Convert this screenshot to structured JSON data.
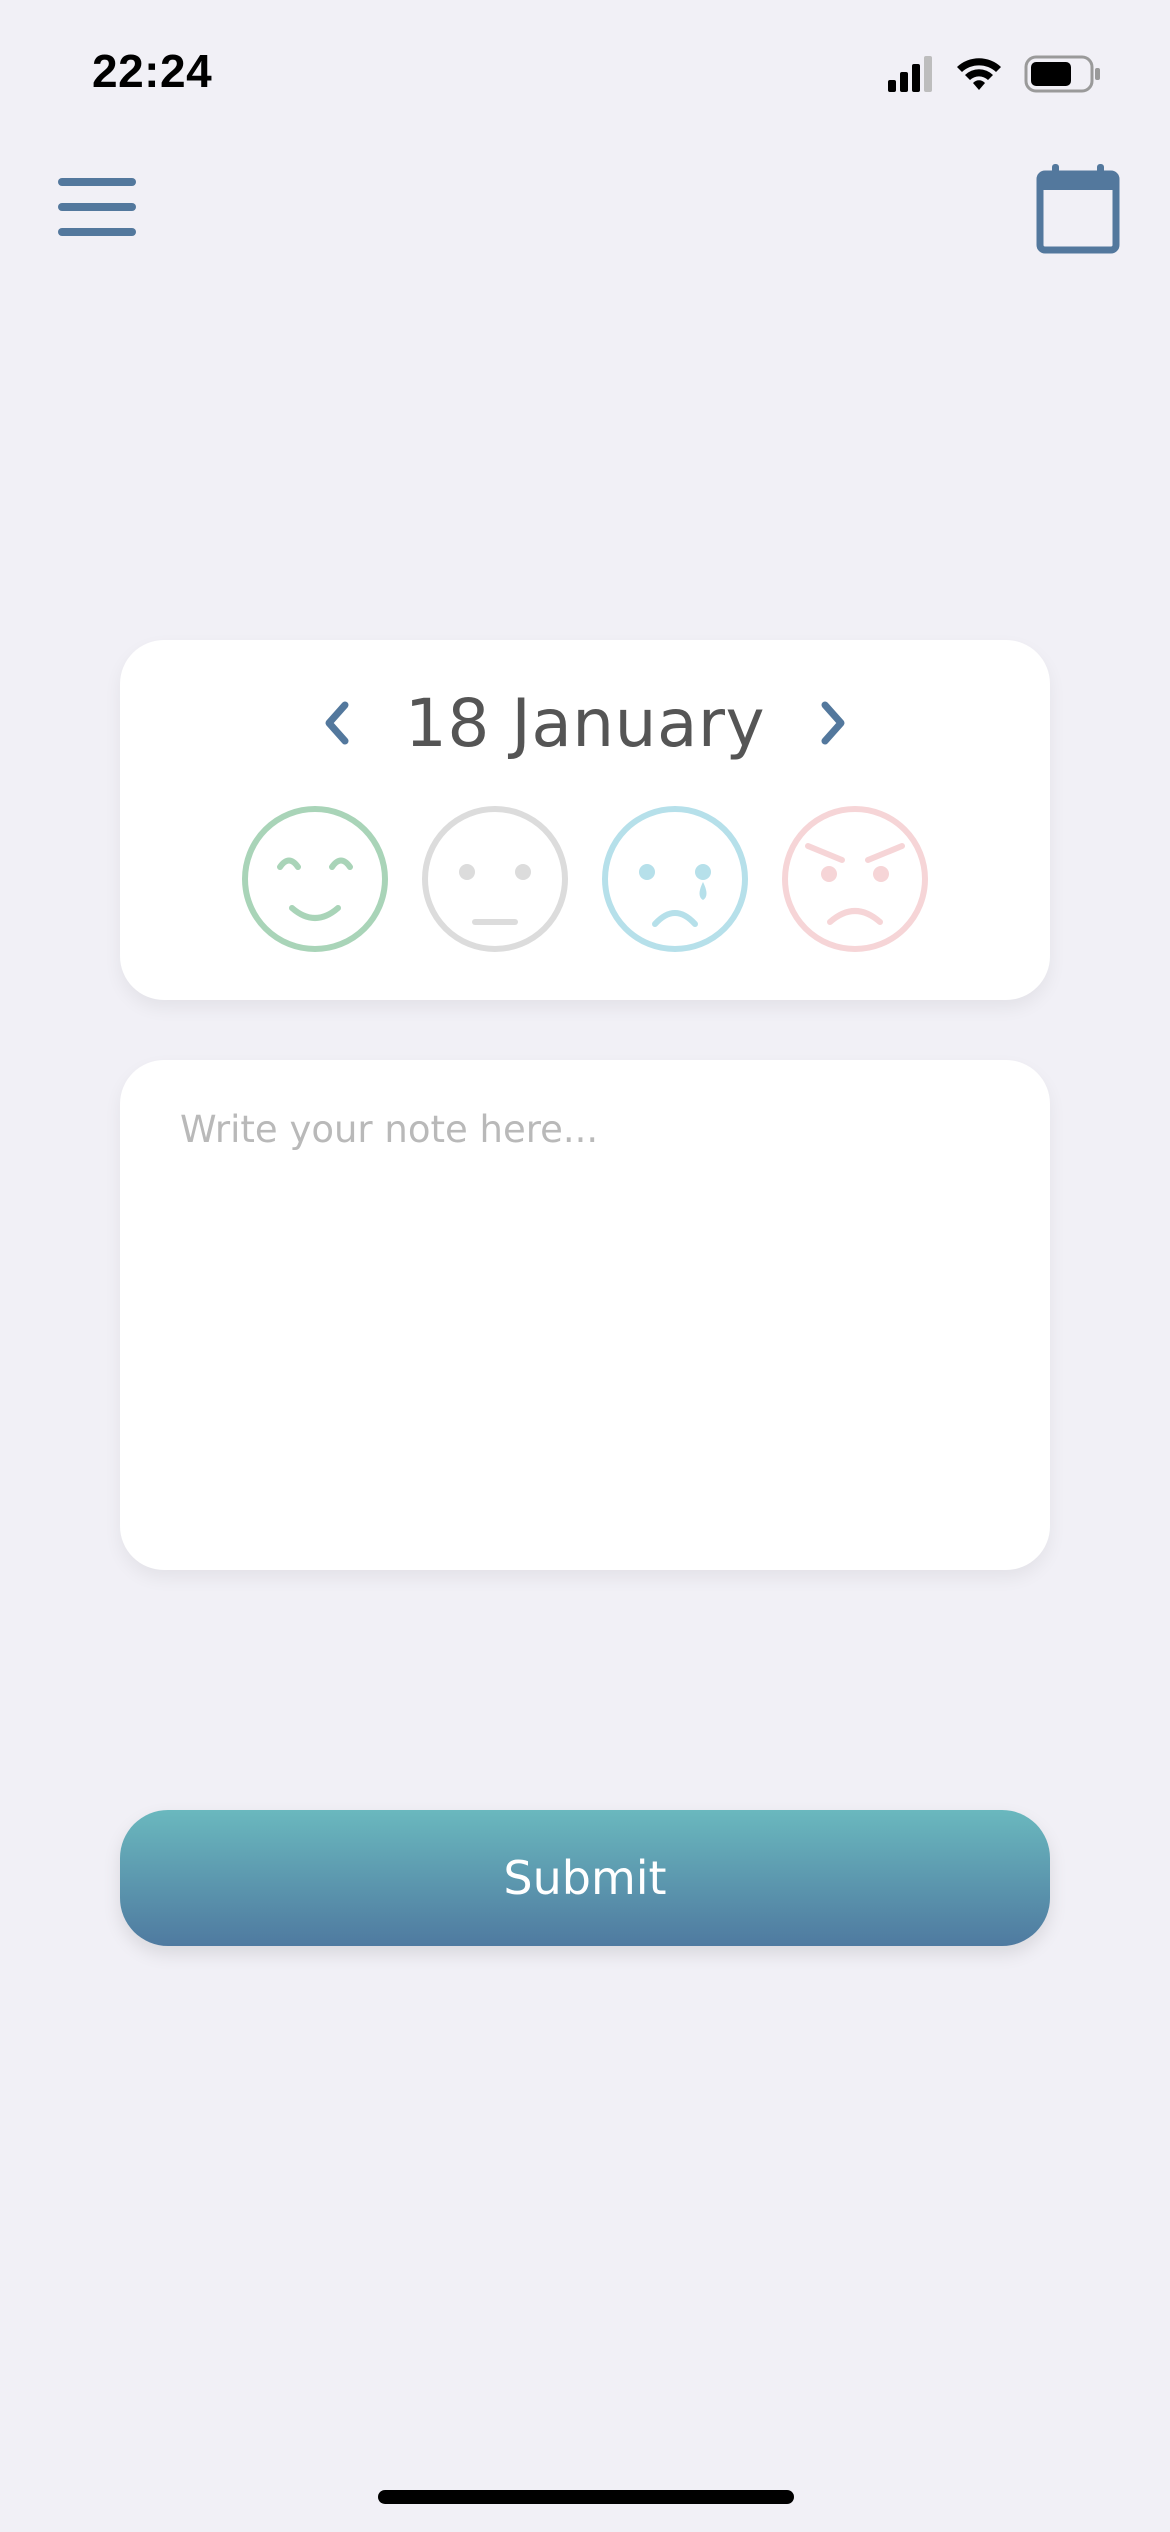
{
  "status_bar": {
    "time": "22:24",
    "icons": [
      "signal-icon",
      "wifi-icon",
      "battery-icon"
    ]
  },
  "nav": {
    "left_icon": "hamburger-menu-icon",
    "right_icon": "calendar-icon",
    "icon_color": "#53789d"
  },
  "mood_card": {
    "date": "18 January",
    "prev_icon": "chevron-left-icon",
    "next_icon": "chevron-right-icon",
    "moods": [
      {
        "name": "happy",
        "icon": "happy-face-icon",
        "color": "#a9d4b8"
      },
      {
        "name": "neutral",
        "icon": "neutral-face-icon",
        "color": "#dcdcdc"
      },
      {
        "name": "sad",
        "icon": "crying-face-icon",
        "color": "#b6e0ea"
      },
      {
        "name": "angry",
        "icon": "angry-face-icon",
        "color": "#f6d5d7"
      }
    ]
  },
  "note": {
    "value": "",
    "placeholder": "Write your note here..."
  },
  "submit": {
    "label": "Submit",
    "gradient_top": "#6ab8be",
    "gradient_bottom": "#4f7aa0"
  }
}
